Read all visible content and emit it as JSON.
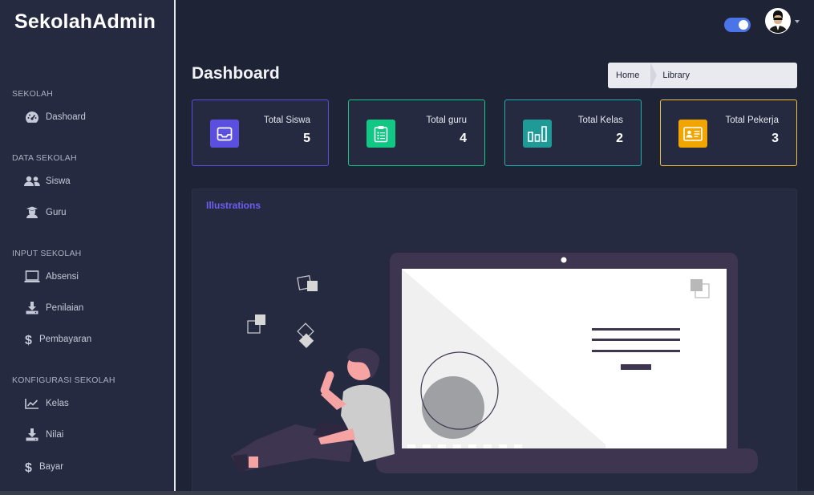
{
  "brand": "SekolahAdmin",
  "sidebar": {
    "sections": [
      {
        "title": "SEKOLAH",
        "items": [
          {
            "label": "Dashoard",
            "icon": "gauge-icon"
          }
        ]
      },
      {
        "title": "DATA SEKOLAH",
        "items": [
          {
            "label": "Siswa",
            "icon": "users-icon"
          },
          {
            "label": "Guru",
            "icon": "graduation-cap-icon"
          }
        ]
      },
      {
        "title": "INPUT SEKOLAH",
        "items": [
          {
            "label": "Absensi",
            "icon": "laptop-icon"
          },
          {
            "label": "Penilaian",
            "icon": "download-icon"
          },
          {
            "label": "Pembayaran",
            "icon": "dollar-icon"
          }
        ]
      },
      {
        "title": "KONFIGURASI SEKOLAH",
        "items": [
          {
            "label": "Kelas",
            "icon": "chart-line-icon"
          },
          {
            "label": "Nilai",
            "icon": "download-icon"
          },
          {
            "label": "Bayar",
            "icon": "dollar-icon"
          }
        ]
      }
    ]
  },
  "header": {
    "page_title": "Dashboard",
    "breadcrumb": {
      "home": "Home",
      "current": "Library"
    },
    "toggle_on": true
  },
  "stats": [
    {
      "label": "Total Siswa",
      "value": "5",
      "color": "#5b4fe0",
      "border": "#5b4fe0",
      "icon": "inbox-icon"
    },
    {
      "label": "Total guru",
      "value": "4",
      "color": "#10c784",
      "border": "#10c784",
      "icon": "clipboard-list-icon"
    },
    {
      "label": "Total Kelas",
      "value": "2",
      "color": "#1f9a97",
      "border": "#1fb0ad",
      "icon": "bar-chart-icon"
    },
    {
      "label": "Total Pekerja",
      "value": "3",
      "color": "#f0a500",
      "border": "#f0c040",
      "icon": "id-card-icon"
    }
  ],
  "panel": {
    "title": "Illustrations"
  },
  "colors": {
    "accent": "#6c5ff0",
    "sidebar_bg": "#262a40",
    "page_bg": "#1f2336"
  }
}
